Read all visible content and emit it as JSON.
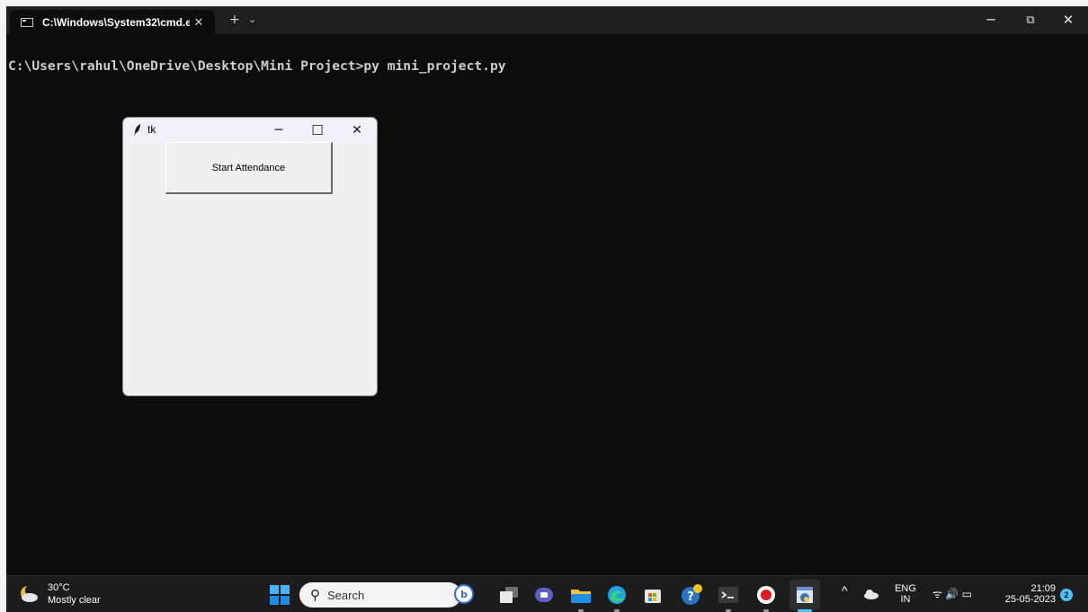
{
  "terminal": {
    "tab_title": "C:\\Windows\\System32\\cmd.e",
    "tab_close": "✕",
    "new_tab": "+",
    "dropdown": "⌄",
    "minimize": "─",
    "maximize": "⧉",
    "close": "✕",
    "prompt_line": "C:\\Users\\rahul\\OneDrive\\Desktop\\Mini Project>py mini_project.py"
  },
  "tk_window": {
    "title": "tk",
    "minimize": "─",
    "maximize": "☐",
    "close": "✕",
    "button_label": "Start Attendance"
  },
  "taskbar": {
    "weather_temp": "30°C",
    "weather_desc": "Mostly clear",
    "search_placeholder": "Search",
    "lang_top": "ENG",
    "lang_bottom": "IN",
    "time": "21:09",
    "date": "25-05-2023",
    "notification_count": "2",
    "tray_chevron": "^",
    "tray_status": "ᯤ 🔊 ▭"
  },
  "colors": {
    "terminal_bg": "#0c0c0c",
    "taskbar_bg": "#1c1c1c",
    "accent": "#4cc2ff"
  }
}
